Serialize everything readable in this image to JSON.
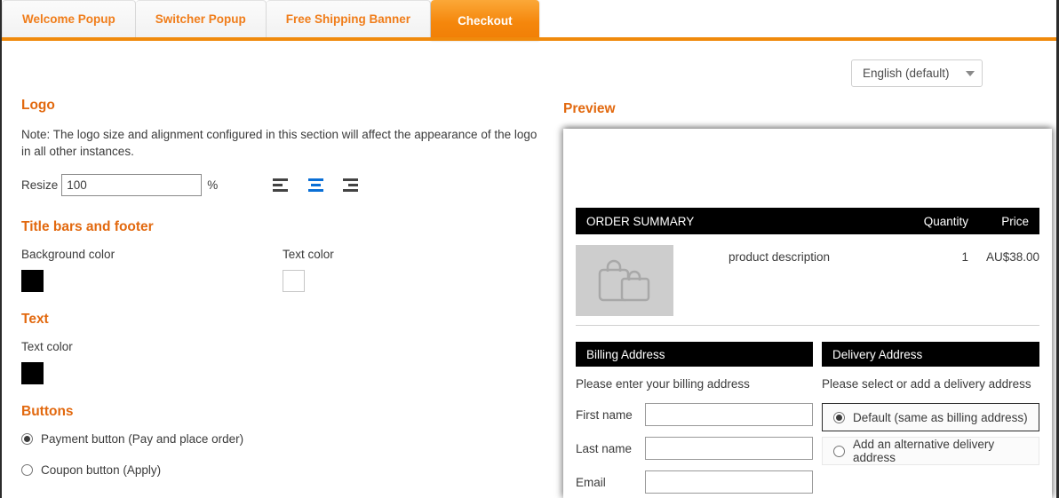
{
  "tabs": [
    {
      "label": "Welcome Popup",
      "active": false
    },
    {
      "label": "Switcher Popup",
      "active": false
    },
    {
      "label": "Free Shipping Banner",
      "active": false
    },
    {
      "label": "Checkout",
      "active": true
    }
  ],
  "language_select": {
    "value": "English (default)",
    "icon": "chevron-down-icon"
  },
  "settings": {
    "logo": {
      "title": "Logo",
      "note": "Note: The logo size and alignment configured in this section will affect the appearance of the logo in all other instances.",
      "resize_label": "Resize",
      "resize_value": "100",
      "percent_symbol": "%",
      "alignment_options": [
        "align-left",
        "align-center",
        "align-right"
      ],
      "alignment_selected": "align-center",
      "alignment_selected_color": "#0a6fd6"
    },
    "title_bars_and_footer": {
      "title": "Title bars and footer",
      "background_color_label": "Background color",
      "background_color_value": "#000000",
      "text_color_label": "Text color",
      "text_color_value": "#ffffff"
    },
    "text": {
      "title": "Text",
      "text_color_label": "Text color",
      "text_color_value": "#000000"
    },
    "buttons": {
      "title": "Buttons",
      "options": [
        {
          "label": "Payment button (Pay and place order)",
          "selected": true
        },
        {
          "label": "Coupon button (Apply)",
          "selected": false
        }
      ]
    }
  },
  "preview": {
    "title": "Preview",
    "order_summary": {
      "heading": "ORDER SUMMARY",
      "quantity_header": "Quantity",
      "price_header": "Price",
      "items": [
        {
          "description": "product description",
          "quantity": "1",
          "price": "AU$38.00",
          "thumb_icon": "shopping-bags-icon"
        }
      ]
    },
    "billing": {
      "heading": "Billing Address",
      "hint": "Please enter your billing address",
      "fields": [
        {
          "label": "First name",
          "value": ""
        },
        {
          "label": "Last name",
          "value": ""
        },
        {
          "label": "Email",
          "value": ""
        }
      ]
    },
    "delivery": {
      "heading": "Delivery Address",
      "hint": "Please select or add a delivery address",
      "options": [
        {
          "label": "Default (same as billing address)",
          "selected": true
        },
        {
          "label": "Add an alternative delivery address",
          "selected": false
        }
      ]
    }
  },
  "theme": {
    "accent_orange": "#f07d1a",
    "heading_orange": "#e2690f",
    "blue": "#0a6fd6"
  }
}
